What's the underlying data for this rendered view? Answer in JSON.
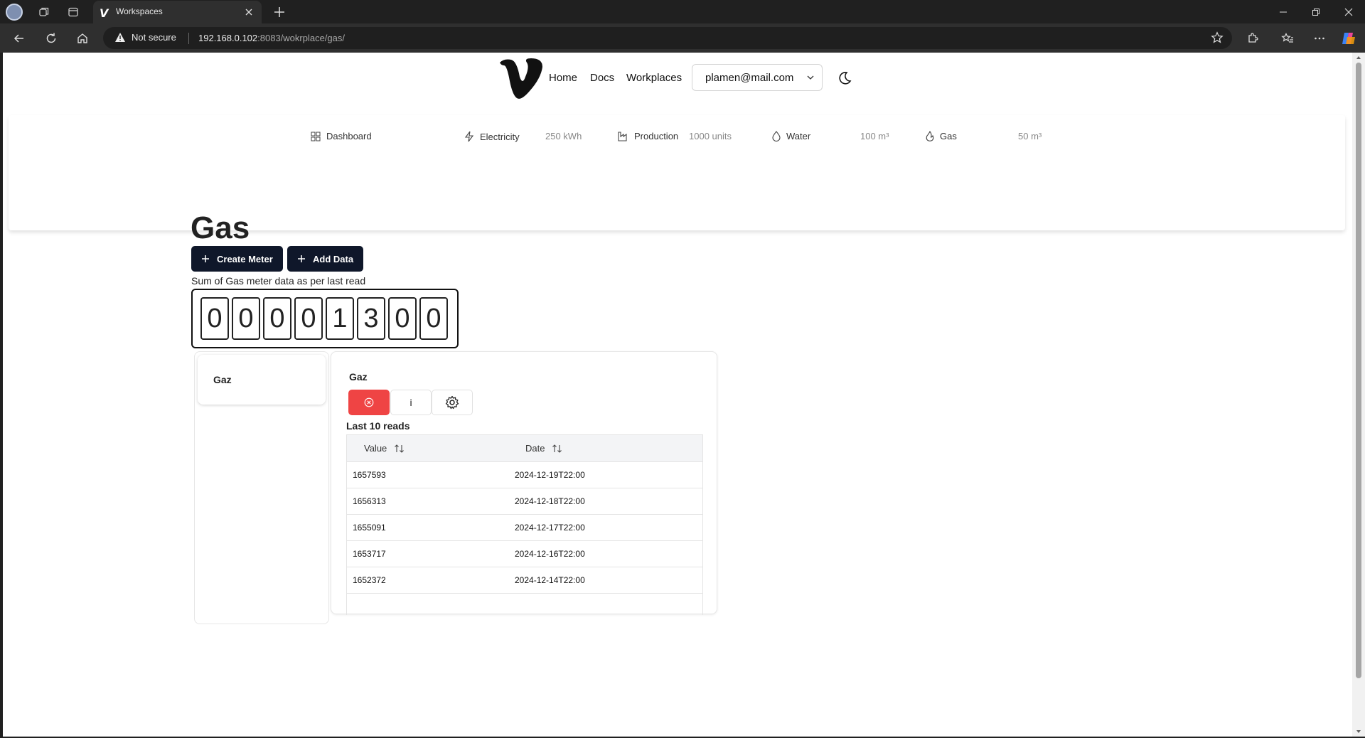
{
  "browser": {
    "tab_title": "Workspaces",
    "security_label": "Not secure",
    "url_host": "192.168.0.102",
    "url_rest": ":8083/wokrplace/gas/"
  },
  "header": {
    "nav": [
      "Home",
      "Docs",
      "Workplaces"
    ],
    "user_email": "plamen@mail.com"
  },
  "categories": [
    {
      "label": "Dashboard",
      "icon": "grid-icon",
      "value": ""
    },
    {
      "label": "Electricity",
      "icon": "bolt-icon",
      "value": "250 kWh"
    },
    {
      "label": "Production",
      "icon": "factory-icon",
      "value": "1000 units"
    },
    {
      "label": "Water",
      "icon": "droplet-icon",
      "value": "100 m³"
    },
    {
      "label": "Gas",
      "icon": "flame-icon",
      "value": "50 m³"
    }
  ],
  "page": {
    "title": "Gas",
    "create_meter_label": "Create Meter",
    "add_data_label": "Add Data",
    "sum_label": "Sum of Gas meter data as per last read",
    "odometer_digits": [
      "0",
      "0",
      "0",
      "0",
      "1",
      "3",
      "0",
      "0"
    ]
  },
  "meters": [
    {
      "name": "Gaz"
    }
  ],
  "meter_detail": {
    "name": "Gaz",
    "info_label": "i",
    "reads_label": "Last 10 reads",
    "columns": [
      "Value",
      "Date"
    ],
    "rows": [
      {
        "value": "1657593",
        "date": "2024-12-19T22:00"
      },
      {
        "value": "1656313",
        "date": "2024-12-18T22:00"
      },
      {
        "value": "1655091",
        "date": "2024-12-17T22:00"
      },
      {
        "value": "1653717",
        "date": "2024-12-16T22:00"
      },
      {
        "value": "1652372",
        "date": "2024-12-14T22:00"
      }
    ]
  },
  "colors": {
    "danger": "#ef4444",
    "primary": "#0f172a"
  }
}
